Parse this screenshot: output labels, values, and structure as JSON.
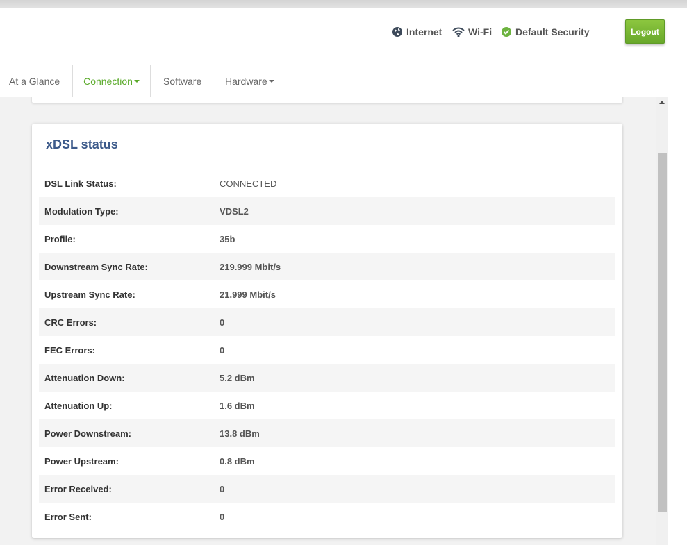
{
  "header": {
    "internet_label": "Internet",
    "wifi_label": "Wi-Fi",
    "security_label": "Default Security",
    "logout_label": "Logout"
  },
  "tabs": [
    {
      "label": "At a Glance",
      "active": false
    },
    {
      "label": "Connection",
      "active": true,
      "dropdown": true
    },
    {
      "label": "Software",
      "active": false
    },
    {
      "label": "Hardware",
      "active": false,
      "dropdown": true
    }
  ],
  "xdsl": {
    "title": "xDSL status",
    "rows": [
      {
        "label": "DSL Link Status:",
        "value": "CONNECTED"
      },
      {
        "label": "Modulation Type:",
        "value": "VDSL2"
      },
      {
        "label": "Profile:",
        "value": "35b"
      },
      {
        "label": "Downstream Sync Rate:",
        "value": "219.999 Mbit/s"
      },
      {
        "label": "Upstream Sync Rate:",
        "value": "21.999 Mbit/s"
      },
      {
        "label": "CRC Errors:",
        "value": "0"
      },
      {
        "label": "FEC Errors:",
        "value": "0"
      },
      {
        "label": "Attenuation Down:",
        "value": "5.2 dBm"
      },
      {
        "label": "Attenuation Up:",
        "value": "1.6 dBm"
      },
      {
        "label": "Power Downstream:",
        "value": "13.8 dBm"
      },
      {
        "label": "Power Upstream:",
        "value": "0.8 dBm"
      },
      {
        "label": "Error Received:",
        "value": "0"
      },
      {
        "label": "Error Sent:",
        "value": "0"
      }
    ]
  },
  "colors": {
    "accent_green": "#5aaa2a",
    "logout_green": "#7ab833",
    "title_blue": "#3c5a8a",
    "security_check_green": "#6db33f"
  }
}
